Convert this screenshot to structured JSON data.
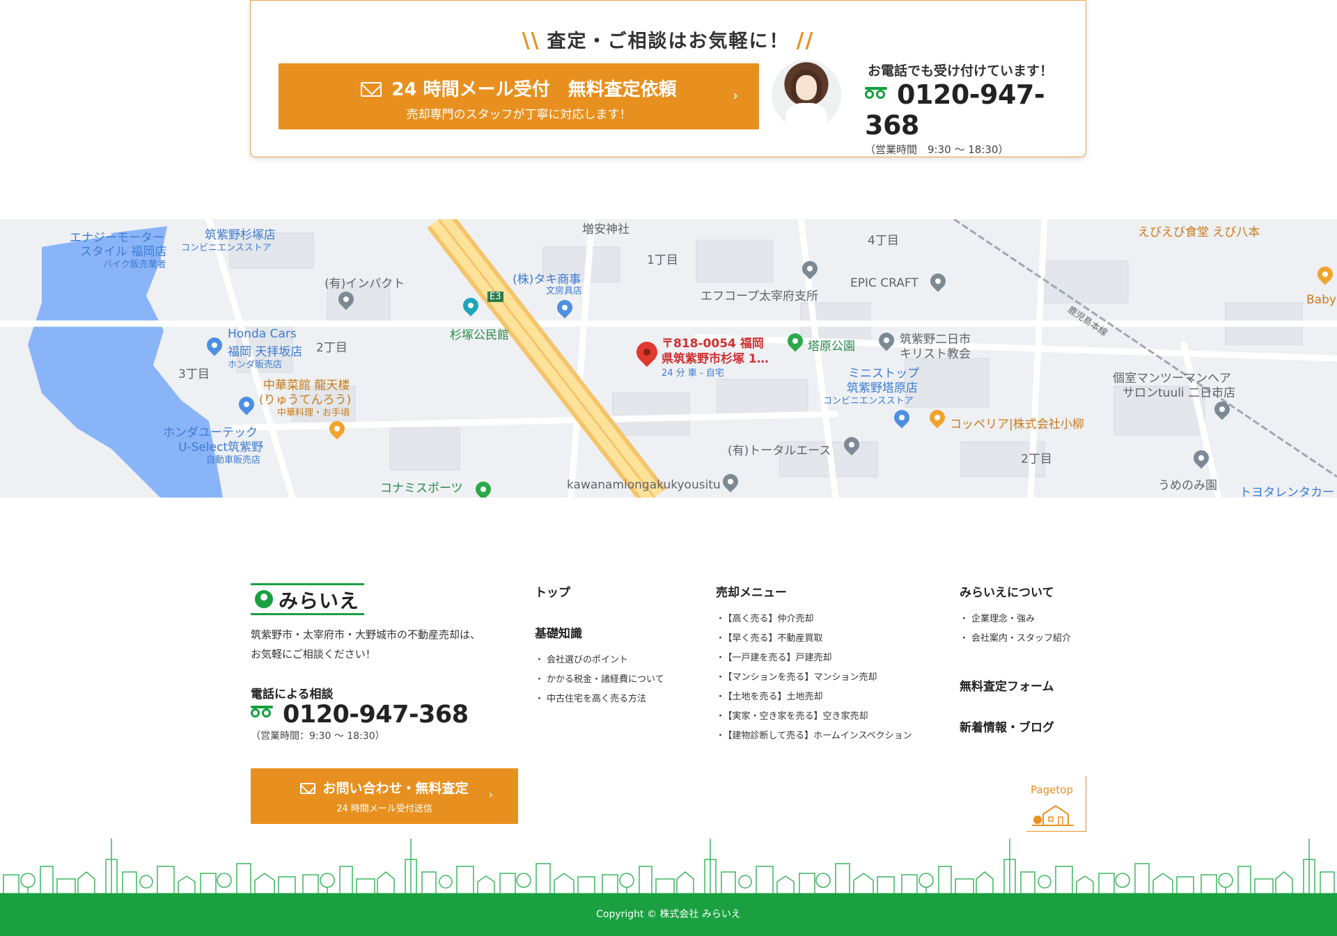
{
  "contact": {
    "heading": "査定・ご相談はお気軽に！",
    "mail_button": {
      "title": "24 時間メール受付　無料査定依頼",
      "subtitle": "売却専門のスタッフが丁寧に対応します！",
      "arrow": "›"
    },
    "phone": {
      "caption": "お電話でも受け付けています！",
      "number": "0120-947-368",
      "hours": "（営業時間　9:30 〜 18:30）"
    }
  },
  "map": {
    "labels": {
      "energy1": "エナジーモーター",
      "energy2": "スタイル 福岡店",
      "energy3": "バイク販売業者",
      "sugitsuka1": "筑紫野杉塚店",
      "sugitsuka2": "コンビニエンスストア",
      "impact": "(有)インパクト",
      "taki": "(株)タキ商事",
      "taki_sub": "文房具店",
      "koumin": "杉塚公民館",
      "e3": "E3",
      "honda1": "Honda Cars",
      "honda2": "福岡 天拝坂店",
      "honda3": "ホンダ販売店",
      "chome2_left": "2丁目",
      "chome3": "3丁目",
      "chuka1": "中華菜館 龍天楼",
      "chuka2": "(りゅうてんろう)",
      "chuka3": "中華料理・お手頃",
      "hondayu1": "ホンダユーテック",
      "hondayu2": "U-Select筑紫野",
      "hondayu3": "自動車販売店",
      "konami": "コナミスポーツ",
      "chome1": "1丁目",
      "chome4": "4丁目",
      "fcoop": "エフコープ太宰府支所",
      "epic": "EPIC CRAFT",
      "tohara": "塔原公園",
      "church1": "筑紫野二日市",
      "church2": "キリスト教会",
      "ministop1": "ミニストップ",
      "ministop2": "筑紫野塔原店",
      "ministop3": "コンビニエンスストア",
      "coppe": "コッペリア|株式会社小柳",
      "total": "(有)トータルエース",
      "kawana": "kawanamiongakukyousitu",
      "chome2_right": "2丁目",
      "umenomi": "うめのみ園",
      "toyota": "トヨタレンタカー",
      "salon1": "個室マンツーマンヘア",
      "salon2": "サロンtuuli 二日市店",
      "ebi": "えびえび食堂 えび八本",
      "baby": "Baby",
      "rail": "鹿児島本線",
      "shrine": "増安神社",
      "dest1": "〒818-0054 福岡",
      "dest2": "県筑紫野市杉塚 1…",
      "dest3": "24 分 車 - 自宅"
    }
  },
  "footer": {
    "logo": "みらいえ",
    "description_1": "筑紫野市・太宰府市・大野城市の不動産売却は、",
    "description_2": "お気軽にご相談ください！",
    "tel_heading": "電話による相談",
    "tel_number": "0120-947-368",
    "tel_hours": "（営業時間：9:30 〜 18:30）",
    "button": {
      "title": "お問い合わせ・無料査定",
      "subtitle": "24 時間メール受付送信",
      "arrow": "›"
    },
    "col1": {
      "top": "トップ",
      "basics": "基礎知識",
      "items": [
        "会社選びのポイント",
        "かかる税金・諸経費について",
        "中古住宅を高く売る方法"
      ]
    },
    "col2": {
      "heading": "売却メニュー",
      "items": [
        "【高く売る】仲介売却",
        "【早く売る】不動産買取",
        "【一戸建を売る】戸建売却",
        "【マンションを売る】マンション売却",
        "【土地を売る】土地売却",
        "【実家・空き家を売る】空き家売却",
        "【建物診断して売る】ホームインスペクション"
      ]
    },
    "col3": {
      "heading": "みらいえについて",
      "items": [
        "企業理念・強み",
        "会社案内・スタッフ紹介"
      ],
      "form": "無料査定フォーム",
      "news": "新着情報・ブログ"
    },
    "pagetop": "Pagetop",
    "copyright": "Copyright © 株式会社 みらいえ"
  },
  "colors": {
    "accent_orange": "#e8901f",
    "brand_green": "#1aa040"
  }
}
